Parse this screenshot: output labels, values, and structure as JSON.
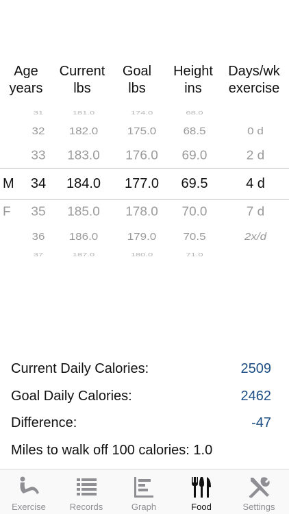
{
  "headers": {
    "age": [
      "Age",
      "years"
    ],
    "current": [
      "Current",
      "lbs"
    ],
    "goal": [
      "Goal",
      "lbs"
    ],
    "height": [
      "Height",
      "ins"
    ],
    "days": [
      "Days/wk",
      "exercise"
    ]
  },
  "picker_rows": [
    {
      "sex": "",
      "age": "31",
      "current": "181.0",
      "goal": "174.0",
      "height": "68.0",
      "days": ""
    },
    {
      "sex": "",
      "age": "32",
      "current": "182.0",
      "goal": "175.0",
      "height": "68.5",
      "days": "0 d"
    },
    {
      "sex": "",
      "age": "33",
      "current": "183.0",
      "goal": "176.0",
      "height": "69.0",
      "days": "2 d"
    },
    {
      "sex": "M",
      "age": "34",
      "current": "184.0",
      "goal": "177.0",
      "height": "69.5",
      "days": "4 d"
    },
    {
      "sex": "F",
      "age": "35",
      "current": "185.0",
      "goal": "178.0",
      "height": "70.0",
      "days": "7 d"
    },
    {
      "sex": "",
      "age": "36",
      "current": "186.0",
      "goal": "179.0",
      "height": "70.5",
      "days": "2x/d"
    },
    {
      "sex": "",
      "age": "37",
      "current": "187.0",
      "goal": "180.0",
      "height": "71.0",
      "days": ""
    }
  ],
  "summary": {
    "current_daily_label": "Current Daily Calories:",
    "current_daily_value": "2509",
    "goal_daily_label": "Goal Daily Calories:",
    "goal_daily_value": "2462",
    "difference_label": "Difference:",
    "difference_value": "-47",
    "miles_label": "Miles to walk off 100 calories: 1.0"
  },
  "tabs": [
    {
      "label": "Exercise",
      "icon": "exercise-icon"
    },
    {
      "label": "Records",
      "icon": "records-icon"
    },
    {
      "label": "Graph",
      "icon": "graph-icon"
    },
    {
      "label": "Food",
      "icon": "food-icon",
      "active": true
    },
    {
      "label": "Settings",
      "icon": "settings-icon"
    }
  ],
  "colors": {
    "value_blue": "#1d4f84",
    "tab_inactive": "#8e8e93",
    "selected_text": "#111111",
    "dim_text": "#9a9a9a"
  }
}
